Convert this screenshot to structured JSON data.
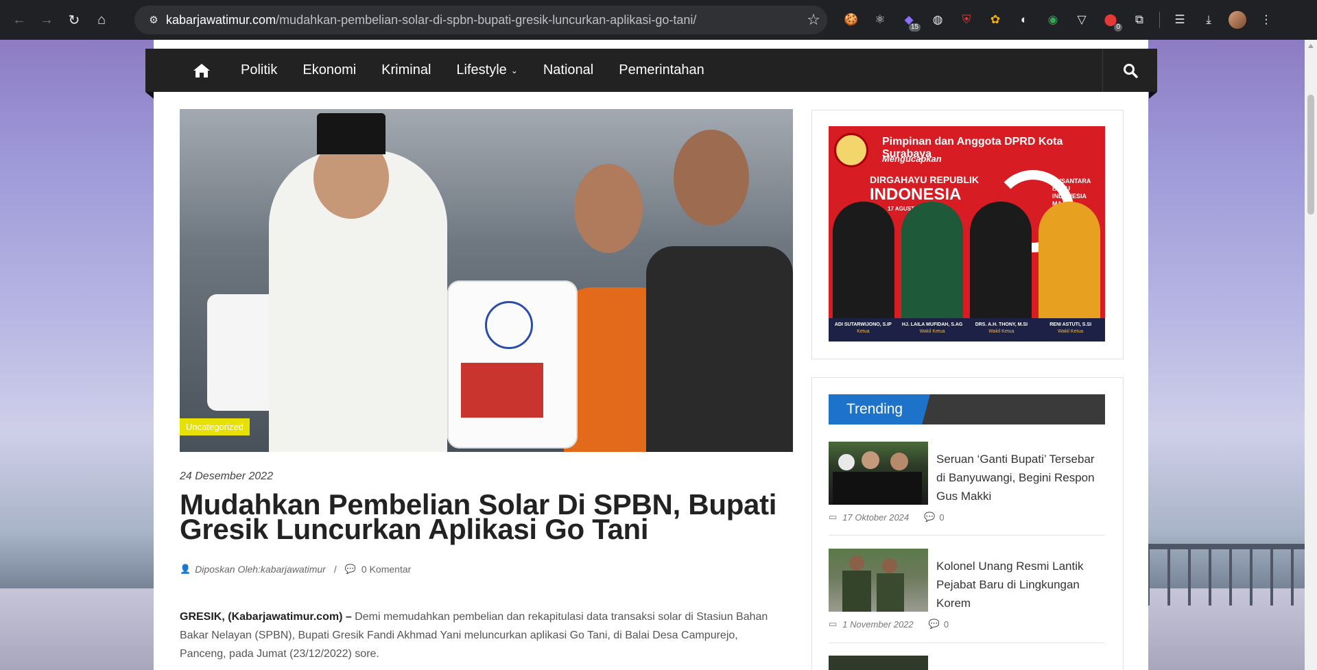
{
  "browser": {
    "url_domain": "kabarjawatimur.com",
    "url_path": "/mudahkan-pembelian-solar-di-spbn-bupati-gresik-luncurkan-aplikasi-go-tani/",
    "extensions": [
      {
        "icon": "cookie-icon",
        "glyph": "🍪",
        "badge": ""
      },
      {
        "icon": "atom-icon",
        "glyph": "⚛",
        "badge": ""
      },
      {
        "icon": "extension-badge-icon",
        "glyph": "◆",
        "badge": "15"
      },
      {
        "icon": "globe-icon",
        "glyph": "◍",
        "badge": ""
      },
      {
        "icon": "shield-icon",
        "glyph": "⛨",
        "badge": ""
      },
      {
        "icon": "color-wheel-icon",
        "glyph": "✿",
        "badge": ""
      },
      {
        "icon": "circle-icon",
        "glyph": "◐",
        "badge": ""
      },
      {
        "icon": "eye-icon",
        "glyph": "◉",
        "badge": ""
      },
      {
        "icon": "vue-icon",
        "glyph": "▽",
        "badge": ""
      },
      {
        "icon": "record-icon",
        "glyph": "⬤",
        "badge": "0"
      },
      {
        "icon": "puzzle-icon",
        "glyph": "⧉",
        "badge": ""
      }
    ]
  },
  "nav": {
    "items": [
      {
        "label": "Politik"
      },
      {
        "label": "Ekonomi"
      },
      {
        "label": "Kriminal"
      },
      {
        "label": "Lifestyle"
      },
      {
        "label": "National"
      },
      {
        "label": "Pemerintahan"
      }
    ]
  },
  "article": {
    "category": "Uncategorized",
    "date": "24 Desember 2022",
    "title": "Mudahkan Pembelian Solar Di SPBN, Bupati Gresik Luncurkan Aplikasi Go Tani",
    "author": "Diposkan Oleh:kabarjawatimur",
    "comments": "0 Komentar",
    "lead": "GRESIK, (Kabarjawatimur.com) –",
    "body": " Demi memudahkan pembelian dan rekapitulasi data transaksi solar di Stasiun Bahan Bakar Nelayan (SPBN), Bupati Gresik Fandi Akhmad Yani meluncurkan aplikasi Go Tani, di Balai Desa Campurejo, Panceng, pada Jumat (23/12/2022) sore."
  },
  "ad": {
    "header": "Pimpinan dan Anggota DPRD Kota Surabaya",
    "sub": "Mengucapkan",
    "line1": "DIRGAHAYU REPUBLIK",
    "line2": "INDONESIA",
    "date": "17 AGUSTUS 2024",
    "theme": "NUSANTARA BARU INDONESIA MAJU",
    "people": [
      {
        "name": "ADI SUTARWIJONO, S.IP",
        "role": "Ketua"
      },
      {
        "name": "HJ. LAILA MUFIDAH, S.AG",
        "role": "Wakil Ketua"
      },
      {
        "name": "DRS. A.H. THONY, M.SI",
        "role": "Wakil Ketua"
      },
      {
        "name": "RENI ASTUTI, S.SI",
        "role": "Wakil Ketua"
      }
    ]
  },
  "trending": {
    "heading": "Trending",
    "items": [
      {
        "title": "Seruan ‘Ganti Bupati’ Tersebar di Banyuwangi, Begini Respon Gus Makki",
        "date": "17 Oktober 2024",
        "comments": "0"
      },
      {
        "title": "Kolonel Unang Resmi Lantik Pejabat Baru di Lingkungan Korem",
        "date": "1 November 2022",
        "comments": "0"
      }
    ]
  }
}
